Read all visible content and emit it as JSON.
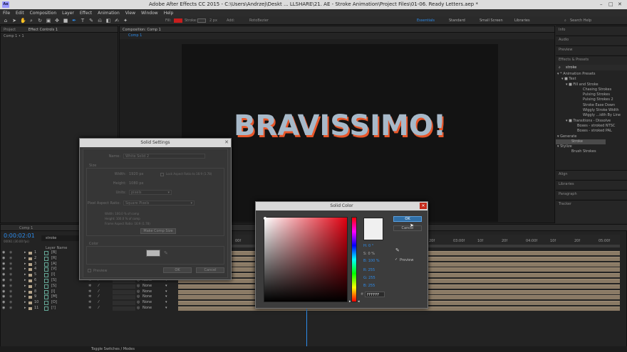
{
  "window": {
    "title": "Adobe After Effects CC 2015 - C:\\Users\\Andrzej\\Deskt ... LLSHARE\\21. AE - Stroke Animation\\Project Files\\01-06. Ready Letters.aep *",
    "logo": "Ae"
  },
  "menu": [
    "File",
    "Edit",
    "Composition",
    "Layer",
    "Effect",
    "Animation",
    "View",
    "Window",
    "Help"
  ],
  "toolbar": {
    "fill": "Fill:",
    "stroke": "Stroke:",
    "stroke_px": "2 px",
    "add": "Add:",
    "rotobezier": "RotoBezier",
    "workspaces": [
      "Essentials",
      "Standard",
      "Small Screen",
      "Libraries"
    ],
    "search": "Search Help"
  },
  "left_tabs": {
    "project": "Project",
    "effect_controls": "Effect Controls 1",
    "comp_label": "Comp 1 • 1"
  },
  "comp": {
    "tab": "Composition: Comp 1",
    "sub_tab": "Comp 1",
    "text": "BRAVISSIMO!"
  },
  "right_panels": {
    "info": "Info",
    "audio": "Audio",
    "preview": "Preview",
    "effects_presets": "Effects & Presets",
    "search_value": "stroke",
    "align": "Align",
    "libraries": "Libraries",
    "paragraph": "Paragraph",
    "tracker": "Tracker"
  },
  "tree": [
    "▾ * Animation Presets",
    "▾ ■ Text",
    "▾ ■ Fill and Stroke",
    "Chasing Strokes",
    "Pulsing Strokes",
    "Pulsing Strokes 2",
    "Stroke Ease Down",
    "Wiggly Stroke Width",
    "Wiggly ...idth By Line",
    "▾ ■ Transitions - Dissolve",
    "Boxes - stroked NTSC",
    "Boxes - stroked PAL",
    "▾ Generate",
    "Stroke",
    "▾ Stylize",
    "Brush Strokes"
  ],
  "solid_settings": {
    "title": "Solid Settings",
    "name_label": "Name:",
    "name_value": "White Solid 2",
    "size_label": "Size",
    "width_label": "Width:",
    "width_value": "1920 px",
    "lock_label": "Lock Aspect Ratio to 16:9 (1.78)",
    "height_label": "Height:",
    "height_value": "1080 px",
    "units_label": "Units:",
    "units_value": "pixels",
    "par_label": "Pixel Aspect Ratio:",
    "par_value": "Square Pixels",
    "info_width": "Width: 100.0 % of comp",
    "info_height": "Height: 100.0 % of comp",
    "info_frame": "Frame Aspect Ratio: 16:9 (1.78)",
    "make_comp_size": "Make Comp Size",
    "color_label": "Color",
    "preview": "Preview",
    "ok": "OK",
    "cancel": "Cancel"
  },
  "solid_color": {
    "title": "Solid Color",
    "ok": "OK",
    "cancel": "Cancel",
    "h": "H: 0 °",
    "s": "S: 0 %",
    "b": "B: 100 %",
    "r": "R: 255",
    "g": "G: 255",
    "bl": "B: 255",
    "hex": "FFFFFF",
    "preview": "Preview",
    "swatch_color": "#f0f0f0"
  },
  "timeline": {
    "tab": "Comp 1",
    "timecode": "0:00:02:01",
    "frames": "00061 (30.00 fps)",
    "search": "stroke",
    "layer_name_header": "Layer Name",
    "toggle": "Toggle Switches / Modes",
    "none": "None",
    "rulers": [
      "00f",
      "10f",
      "20f",
      "01:00f",
      "10f",
      "20f",
      "02:00f",
      "10f",
      "20f",
      "03:00f",
      "10f",
      "20f",
      "04:00f",
      "10f",
      "20f",
      "05:00f"
    ],
    "layers": [
      {
        "n": "1",
        "name": "[B]"
      },
      {
        "n": "2",
        "name": "[R]"
      },
      {
        "n": "3",
        "name": "[A]"
      },
      {
        "n": "4",
        "name": "[V]"
      },
      {
        "n": "5",
        "name": "[I]"
      },
      {
        "n": "6",
        "name": "[S]"
      },
      {
        "n": "7",
        "name": "[S]"
      },
      {
        "n": "8",
        "name": "[I]"
      },
      {
        "n": "9",
        "name": "[M]"
      },
      {
        "n": "10",
        "name": "[O]"
      },
      {
        "n": "11",
        "name": "[!]"
      }
    ]
  },
  "colors": {
    "accent": "#2d8ceb",
    "layer_bar": "#8a7a65",
    "title_bg": "#dcdcdc"
  }
}
